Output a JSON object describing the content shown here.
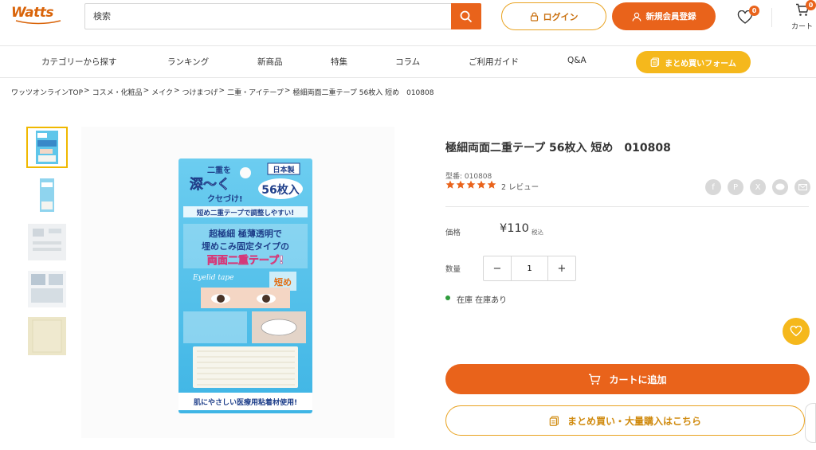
{
  "header": {
    "logo_text": "Watts",
    "search": {
      "placeholder": "検索",
      "value": ""
    },
    "login_label": "ログイン",
    "register_label": "新規会員登録",
    "fav_count": "0",
    "cart_count": "0",
    "cart_label": "カート"
  },
  "nav": {
    "items": [
      "カテゴリーから探す",
      "ランキング",
      "新商品",
      "特集",
      "コラム",
      "ご利用ガイド",
      "Q&A"
    ],
    "cta_label": "まとめ買いフォーム"
  },
  "breadcrumb": [
    "ワッツオンラインTOP",
    "コスメ・化粧品",
    "メイク",
    "つけまつげ",
    "二重・アイテープ",
    "極細両面二重テープ 56枚入 短め　010808"
  ],
  "breadcrumb_sep": ">",
  "product": {
    "title": "極細両面二重テープ 56枚入 短め　010808",
    "sku_label": "型番: 010808",
    "rating": 5,
    "review_text": "2 レビュー",
    "price_label": "価格",
    "price": "¥110",
    "tax_label": "税込",
    "qty_label": "数量",
    "qty_value": "1",
    "stock_text": "在庫 在庫あり",
    "add_to_cart": "カートに追加",
    "bulk_label": "まとめ買い・大量購入はこちら"
  },
  "package": {
    "made_in": "日本製",
    "count": "56枚入",
    "headline1": "二重を",
    "headline2": "深～く",
    "headline3": "クセづけ!",
    "short_line": "短め二重テープで調整しやすい!",
    "main1": "超極細 極薄透明で",
    "main2": "埋めこみ固定タイプの",
    "main3": "両面二重テープ!",
    "eyelid": "Eyelid tape",
    "short_type": "短め",
    "bottom": "肌にやさしい医療用粘着材使用!"
  },
  "icons": {
    "search": "search-icon",
    "lock": "lock-icon",
    "user": "user-icon",
    "heart": "heart-icon",
    "cart": "cart-icon",
    "star": "star-icon"
  },
  "colors": {
    "accent": "#e9631b",
    "yellow": "#f5b81c",
    "gold_border": "#e9a321",
    "stock_green": "#2e9b3c"
  }
}
